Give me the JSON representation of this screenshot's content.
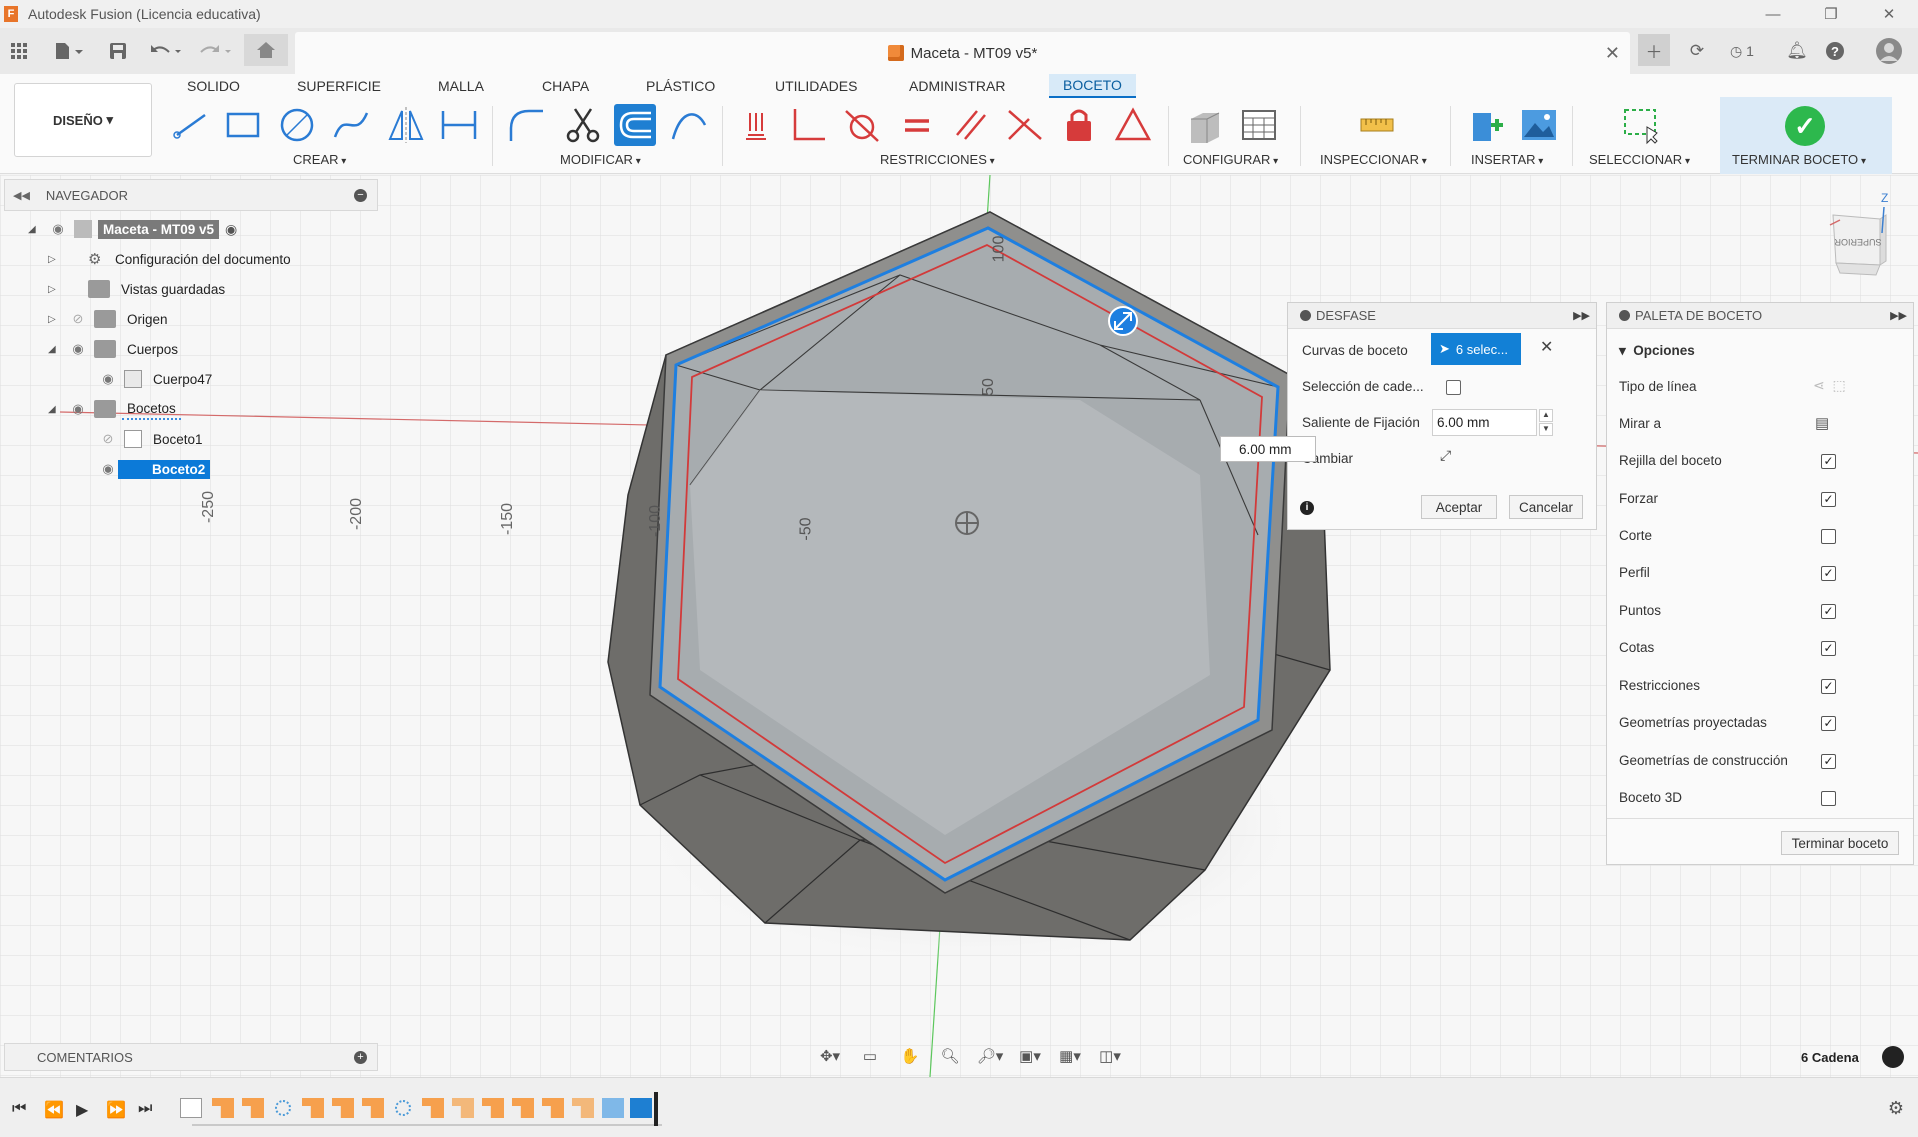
{
  "window": {
    "title": "Autodesk Fusion (Licencia educativa)",
    "app_icon_letter": "F",
    "controls": [
      "—",
      "❐",
      "✕"
    ]
  },
  "document": {
    "tab_title": "Maceta - MT09 v5*",
    "jobs_count": "1"
  },
  "ribbon": {
    "workspace": "DISEÑO",
    "tabs": [
      "SOLIDO",
      "SUPERFICIE",
      "MALLA",
      "CHAPA",
      "PLÁSTICO",
      "UTILIDADES",
      "ADMINISTRAR",
      "BOCETO"
    ],
    "active_tab": "BOCETO",
    "groups": {
      "create": "CREAR",
      "modify": "MODIFICAR",
      "constraints": "RESTRICCIONES",
      "configure": "CONFIGURAR",
      "inspect": "INSPECCIONAR",
      "insert": "INSERTAR",
      "select": "SELECCIONAR",
      "finish": "TERMINAR BOCETO"
    }
  },
  "browser": {
    "title": "NAVEGADOR",
    "root": "Maceta - MT09 v5",
    "items": [
      {
        "label": "Configuración del documento"
      },
      {
        "label": "Vistas guardadas"
      },
      {
        "label": "Origen"
      },
      {
        "label": "Cuerpos"
      },
      {
        "label": "Cuerpo47"
      },
      {
        "label": "Bocetos"
      },
      {
        "label": "Boceto1"
      },
      {
        "label": "Boceto2"
      }
    ]
  },
  "viewport": {
    "axis_labels": [
      "-250",
      "-200",
      "-150",
      "-100",
      "-50",
      "50",
      "100"
    ],
    "viewcube_face": "SUPERIOR",
    "viewcube_axis": "Z"
  },
  "offset_dialog": {
    "title": "DESFASE",
    "curves_label": "Curvas de boceto",
    "curves_value": "6 selec...",
    "chain_label": "Selección de cade...",
    "offset_label": "Saliente de Fijación",
    "offset_value": "6.00 mm",
    "flip_label": "Cambiar",
    "ok": "Aceptar",
    "cancel": "Cancelar"
  },
  "inline_dimension": "6.00 mm",
  "palette": {
    "title": "PALETA DE BOCETO",
    "section": "Opciones",
    "rows": [
      {
        "label": "Tipo de línea"
      },
      {
        "label": "Mirar a"
      },
      {
        "label": "Rejilla del boceto",
        "checked": true
      },
      {
        "label": "Forzar",
        "checked": true
      },
      {
        "label": "Corte",
        "checked": false
      },
      {
        "label": "Perfil",
        "checked": true
      },
      {
        "label": "Puntos",
        "checked": true
      },
      {
        "label": "Cotas",
        "checked": true
      },
      {
        "label": "Restricciones",
        "checked": true
      },
      {
        "label": "Geometrías proyectadas",
        "checked": true
      },
      {
        "label": "Geometrías de construcción",
        "checked": true
      },
      {
        "label": "Boceto 3D",
        "checked": false
      }
    ],
    "finish_button": "Terminar boceto"
  },
  "comments": {
    "title": "COMENTARIOS"
  },
  "status": {
    "selection": "6 Cadena"
  },
  "colors": {
    "accent": "#1280d6",
    "finish_green": "#2db84d",
    "selected_curve": "#1e7fe0",
    "offset_curve": "#d23a3a"
  }
}
